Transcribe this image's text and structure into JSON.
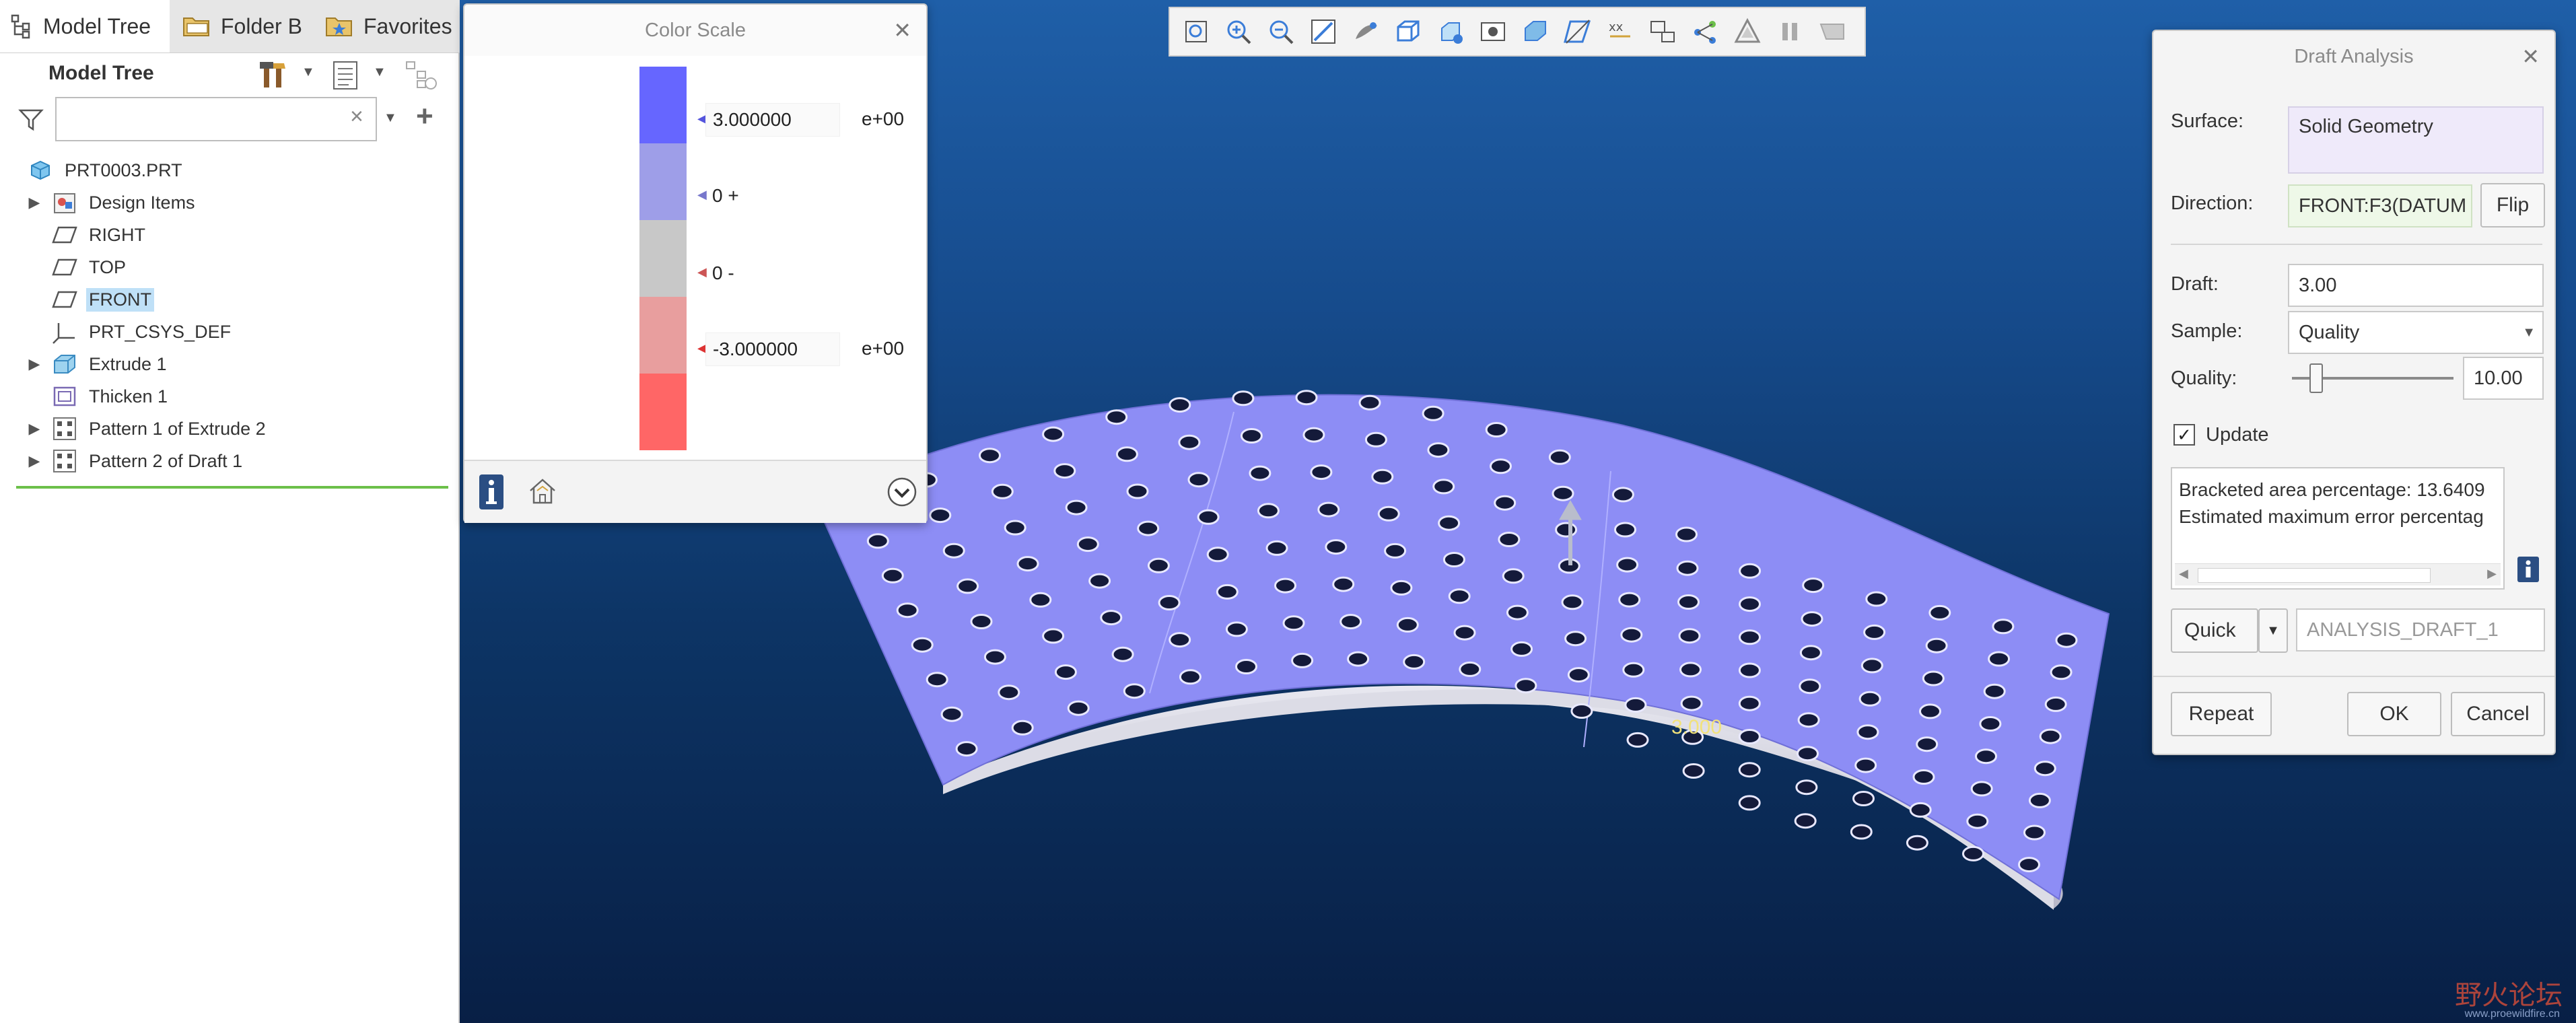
{
  "left_panel": {
    "tabs": [
      {
        "label": "Model Tree",
        "icon": "model-tree-icon",
        "active": true
      },
      {
        "label": "Folder B",
        "icon": "folder-icon",
        "active": false
      },
      {
        "label": "Favorites",
        "icon": "favorites-icon",
        "active": false
      }
    ],
    "tree_title": "Model Tree",
    "search_placeholder": "",
    "items": [
      {
        "label": "PRT0003.PRT",
        "icon": "part-icon",
        "expandable": false,
        "level": 0
      },
      {
        "label": "Design Items",
        "icon": "design-items-icon",
        "expandable": true,
        "level": 1
      },
      {
        "label": "RIGHT",
        "icon": "datum-plane-icon",
        "expandable": false,
        "level": 1
      },
      {
        "label": "TOP",
        "icon": "datum-plane-icon",
        "expandable": false,
        "level": 1
      },
      {
        "label": "FRONT",
        "icon": "datum-plane-icon",
        "expandable": false,
        "level": 1,
        "selected": true
      },
      {
        "label": "PRT_CSYS_DEF",
        "icon": "csys-icon",
        "expandable": false,
        "level": 1
      },
      {
        "label": "Extrude 1",
        "icon": "extrude-icon",
        "expandable": true,
        "level": 1
      },
      {
        "label": "Thicken 1",
        "icon": "thicken-icon",
        "expandable": false,
        "level": 1
      },
      {
        "label": "Pattern 1 of Extrude 2",
        "icon": "pattern-icon",
        "expandable": true,
        "level": 1
      },
      {
        "label": "Pattern 2 of Draft 1",
        "icon": "pattern-icon",
        "expandable": true,
        "level": 1
      }
    ]
  },
  "color_scale": {
    "title": "Color Scale",
    "colors": [
      "#6666ff",
      "#9e9ee8",
      "#c8c8c8",
      "#e89e9e",
      "#ff6666"
    ],
    "labels": [
      {
        "value": "3.000000",
        "exp": "e+00",
        "marker_color": "#5555dd"
      },
      {
        "value": "0 +",
        "exp": "",
        "marker_color": "#7777cc"
      },
      {
        "value": "0 -",
        "exp": "",
        "marker_color": "#cc5555"
      },
      {
        "value": "-3.000000",
        "exp": "e+00",
        "marker_color": "#dd3333"
      }
    ]
  },
  "viewport": {
    "annotation": "3.000",
    "model_color": "#8d8df5",
    "watermark": "野火论坛",
    "watermark_url": "www.proewildfire.cn"
  },
  "toolbar": {
    "buttons": [
      "refit-icon",
      "zoom-in-icon",
      "zoom-out-icon",
      "repaint-icon",
      "display-style-icon",
      "saved-orientations-icon",
      "view-manager-icon",
      "perspective-icon",
      "section-icon",
      "datum-display-icon",
      "annotation-display-icon",
      "spin-center-icon",
      "layers-icon",
      "appearance-icon",
      "pause-icon",
      "stop-icon"
    ]
  },
  "draft_analysis": {
    "title": "Draft Analysis",
    "surface_label": "Surface:",
    "surface_value": "Solid Geometry",
    "direction_label": "Direction:",
    "direction_value": "FRONT:F3(DATUM",
    "flip_label": "Flip",
    "draft_label": "Draft:",
    "draft_value": "3.00",
    "sample_label": "Sample:",
    "sample_value": "Quality",
    "quality_label": "Quality:",
    "quality_value": "10.00",
    "quality_slider": 0.15,
    "update_label": "Update",
    "update_checked": true,
    "info_lines": [
      "Bracketed area percentage: 13.6409",
      "Estimated maximum error percentag"
    ],
    "quick_label": "Quick",
    "analysis_name": "ANALYSIS_DRAFT_1",
    "repeat_label": "Repeat",
    "ok_label": "OK",
    "cancel_label": "Cancel"
  }
}
